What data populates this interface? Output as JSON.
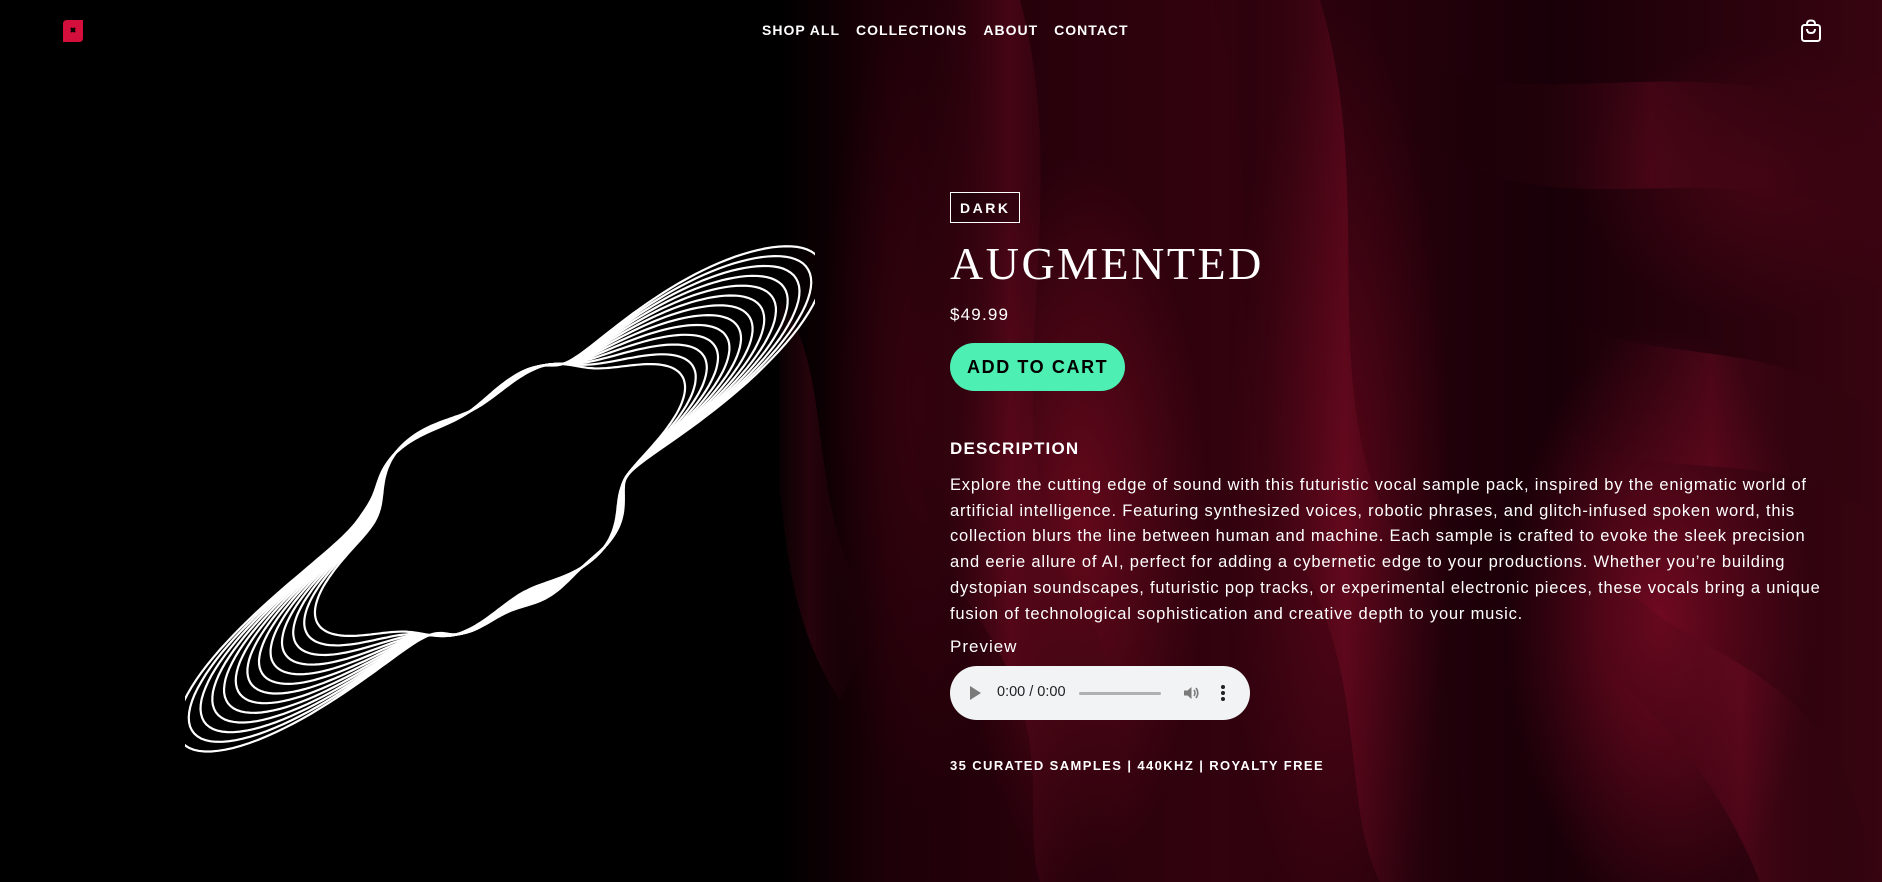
{
  "nav": {
    "items": [
      {
        "label": "SHOP ALL"
      },
      {
        "label": "COLLECTIONS"
      },
      {
        "label": "ABOUT"
      },
      {
        "label": "CONTACT"
      }
    ]
  },
  "icons": {
    "logo": "brand-logo-icon",
    "cart": "shopping-bag-icon",
    "play": "play-icon",
    "volume": "volume-icon",
    "more": "more-vertical-icon"
  },
  "colors": {
    "accent": "#4df0b2",
    "brand": "#d40f3c",
    "background": "#000000",
    "silk": "#5a0618"
  },
  "product": {
    "tag": "DARK",
    "title": "AUGMENTED",
    "price": "$49.99",
    "add_to_cart": "ADD TO CART",
    "description_heading": "DESCRIPTION",
    "description": "Explore the cutting edge of sound with this futuristic vocal sample pack, inspired by the enigmatic world of artificial intelligence. Featuring synthesized voices, robotic phrases, and glitch-infused spoken word, this collection blurs the line between human and machine. Each sample is crafted to evoke the sleek precision and eerie allure of AI, perfect for adding a cybernetic edge to your productions. Whether you’re building dystopian soundscapes, futuristic pop tracks, or experimental electronic pieces, these vocals bring a unique fusion of technological sophistication and creative depth to your music.",
    "preview_label": "Preview",
    "audio_time": "0:00 / 0:00",
    "meta": "35 CURATED SAMPLES | 440KHZ | ROYALTY FREE"
  }
}
